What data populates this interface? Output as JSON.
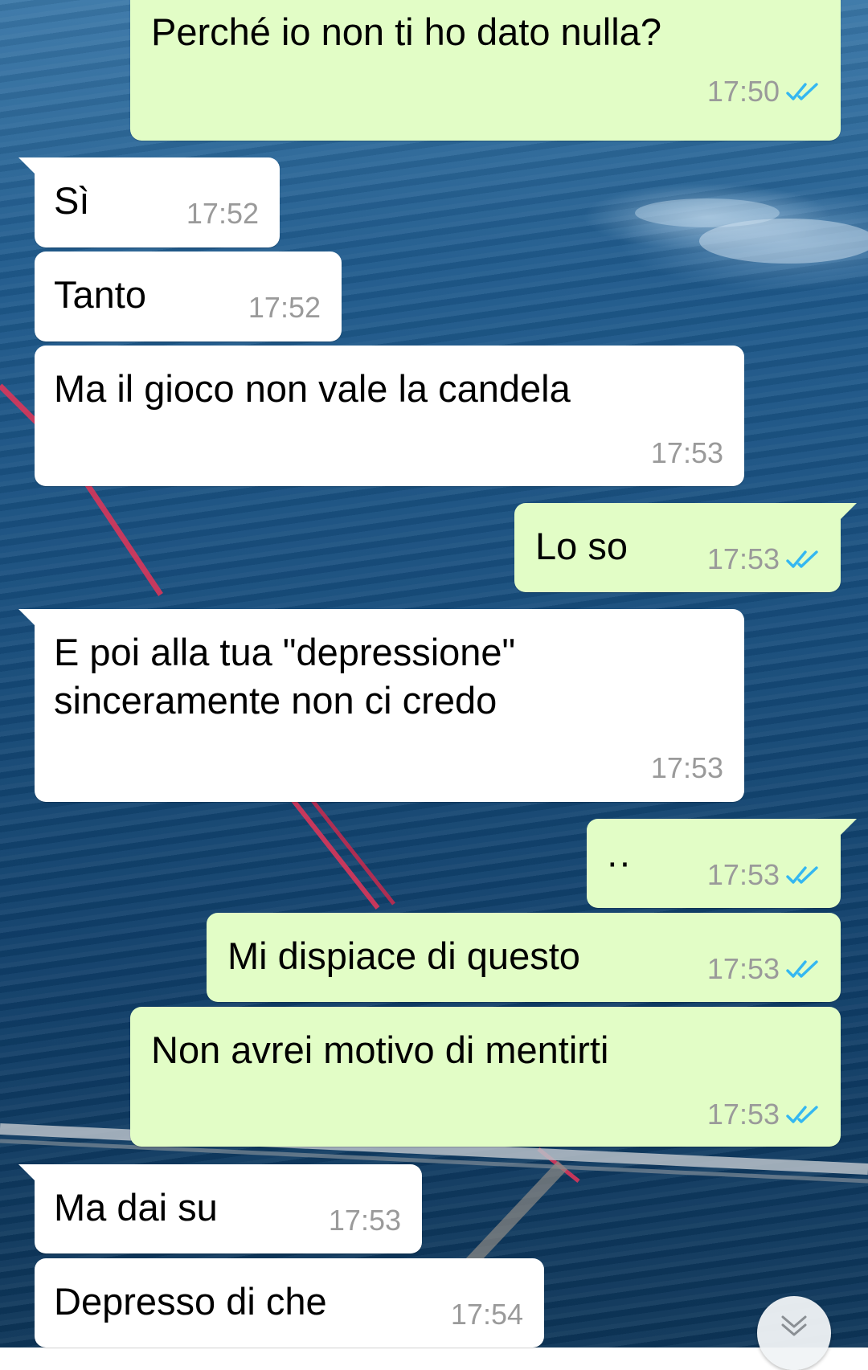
{
  "messages": [
    {
      "direction": "out",
      "text": "Perché io non ti ho dato nulla?",
      "time": "17:50",
      "status": "read"
    },
    {
      "direction": "in",
      "text": "Sì",
      "time": "17:52"
    },
    {
      "direction": "in",
      "text": "Tanto",
      "time": "17:52"
    },
    {
      "direction": "in",
      "text": "Ma il gioco non vale la candela",
      "time": "17:53"
    },
    {
      "direction": "out",
      "text": "Lo so",
      "time": "17:53",
      "status": "read"
    },
    {
      "direction": "in",
      "text": "E poi alla tua \"depressione\"\nsinceramente non ci credo",
      "time": "17:53"
    },
    {
      "direction": "out",
      "text": "··",
      "time": "17:53",
      "status": "read"
    },
    {
      "direction": "out",
      "text": "Mi dispiace di questo",
      "time": "17:53",
      "status": "read"
    },
    {
      "direction": "out",
      "text": "Non avrei motivo di mentirti",
      "time": "17:53",
      "status": "read"
    },
    {
      "direction": "in",
      "text": "Ma dai su",
      "time": "17:53"
    },
    {
      "direction": "in",
      "text": "Depresso di che",
      "time": "17:54"
    }
  ],
  "colors": {
    "outgoing_bubble": "#e2fdc6",
    "incoming_bubble": "#ffffff",
    "read_ticks": "#34b7f1",
    "timestamp": "#9a9a9a"
  },
  "icons": {
    "read_receipt": "double-check-icon",
    "scroll_down": "chevron-double-down-icon"
  }
}
